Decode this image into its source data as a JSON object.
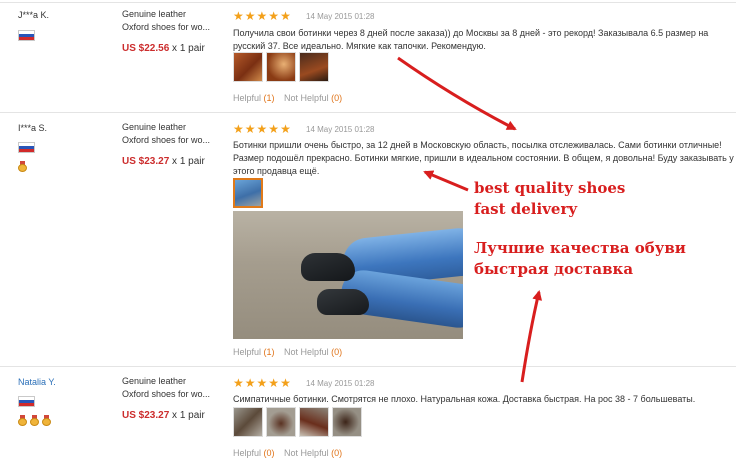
{
  "reviews": [
    {
      "buyer": "J***a K.",
      "product_line1": "Genuine leather",
      "product_line2": "Oxford shoes for wo...",
      "price": "US $22.56",
      "qty": "x 1 pair",
      "rating": 5,
      "date": "14 May 2015 01:28",
      "text": "Получила свои ботинки через 8 дней после заказа)) до Москвы за 8 дней - это рекорд! Заказывала 6.5 размер на русский 37. Все идеально. Мягкие как тапочки. Рекомендую.",
      "helpful_label": "Helpful",
      "helpful_count": "(1)",
      "not_helpful_label": "Not Helpful",
      "not_helpful_count": "(0)"
    },
    {
      "buyer": "I***a S.",
      "product_line1": "Genuine leather",
      "product_line2": "Oxford shoes for wo...",
      "price": "US $23.27",
      "qty": "x 1 pair",
      "rating": 5,
      "date": "14 May 2015 01:28",
      "text": "Ботинки пришли очень быстро, за 12 дней в Московскую область, посылка отслеживалась. Сами ботинки отличные! Размер подошёл прекрасно. Ботинки мягкие, пришли в идеальном состоянии. В общем, я довольна! Буду заказывать у этого продавца ещё.",
      "helpful_label": "Helpful",
      "helpful_count": "(1)",
      "not_helpful_label": "Not Helpful",
      "not_helpful_count": "(0)"
    },
    {
      "buyer": "Natalia Y.",
      "product_line1": "Genuine leather",
      "product_line2": "Oxford shoes for wo...",
      "price": "US $23.27",
      "qty": "x 1 pair",
      "rating": 5,
      "date": "14 May 2015 01:28",
      "text": "Симпатичные ботинки. Смотрятся не плохо. Натуральная кожа. Доставка быстрая. На рос 38 - 7 большеваты.",
      "helpful_label": "Helpful",
      "helpful_count": "(0)",
      "not_helpful_label": "Not Helpful",
      "not_helpful_count": "(0)"
    }
  ],
  "annotations": {
    "en_line1": "best quality shoes",
    "en_line2": "fast delivery",
    "ru_line1": "Лучшие качества обуви",
    "ru_line2": "быстрая доставка"
  },
  "colors": {
    "price": "#cc2d2d",
    "star": "#f3a01a",
    "annotation": "#d81e1e",
    "buyer_link": "#2a6fb8",
    "helpful_count": "#e0741a"
  },
  "icons": {
    "flag": "russia-flag-icon",
    "medal": "buyer-medal-icon",
    "star": "star-icon"
  }
}
